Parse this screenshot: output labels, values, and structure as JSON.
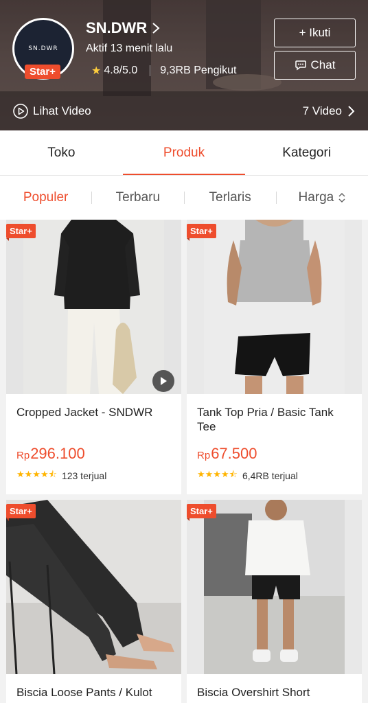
{
  "shop": {
    "logo_text": "SN.DWR",
    "badge": "Star+",
    "name": "SN.DWR",
    "active": "Aktif 13 menit lalu",
    "rating": "4.8/5.0",
    "followers": "9,3RB Pengikut",
    "follow_label": "+ Ikuti",
    "chat_label": "Chat",
    "video_label": "Lihat Video",
    "video_count": "7 Video"
  },
  "tabs": [
    {
      "label": "Toko",
      "active": false
    },
    {
      "label": "Produk",
      "active": true
    },
    {
      "label": "Kategori",
      "active": false
    }
  ],
  "sort": [
    {
      "label": "Populer",
      "active": true
    },
    {
      "label": "Terbaru",
      "active": false
    },
    {
      "label": "Terlaris",
      "active": false
    },
    {
      "label": "Harga",
      "active": false
    }
  ],
  "products": [
    {
      "badge": "Star+",
      "name": "Cropped Jacket - SNDWR",
      "currency": "Rp",
      "price": "296.100",
      "sold": "123 terjual",
      "rating": 4.5,
      "has_video": true
    },
    {
      "badge": "Star+",
      "name": "Tank Top Pria / Basic Tank Tee",
      "currency": "Rp",
      "price": "67.500",
      "sold": "6,4RB terjual",
      "rating": 4.5,
      "has_video": false
    },
    {
      "badge": "Star+",
      "name": "Biscia Loose Pants / Kulot",
      "currency": "",
      "price": "",
      "sold": "",
      "rating": 0,
      "has_video": false
    },
    {
      "badge": "Star+",
      "name": "Biscia Overshirt Short",
      "currency": "",
      "price": "",
      "sold": "",
      "rating": 0,
      "has_video": false
    }
  ],
  "colors": {
    "accent": "#ee4d2d",
    "star": "#ffb400"
  }
}
